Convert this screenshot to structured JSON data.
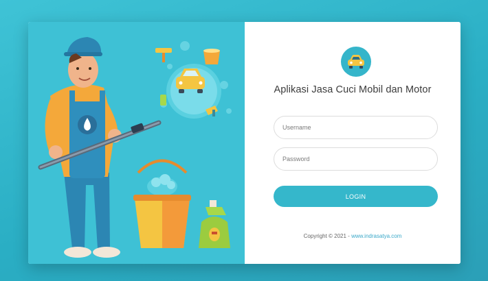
{
  "app": {
    "title": "Aplikasi Jasa Cuci Mobil dan Motor",
    "logo_icon": "car-icon"
  },
  "form": {
    "username_placeholder": "Username",
    "password_placeholder": "Password",
    "login_label": "LOGIN"
  },
  "footer": {
    "copyright_text": "Copyright © 2021 - ",
    "link_text": "www.indrasatya.com"
  },
  "colors": {
    "background": "#2fb3c8",
    "illustration_bg": "#3ec1d5",
    "accent": "#35b7cb",
    "link": "#3aa8c9"
  },
  "illustration": {
    "subject": "car-wash-worker-illustration",
    "icons": [
      "car-icon",
      "bucket-icon",
      "spray-bottle-icon",
      "pressure-washer-icon"
    ]
  }
}
